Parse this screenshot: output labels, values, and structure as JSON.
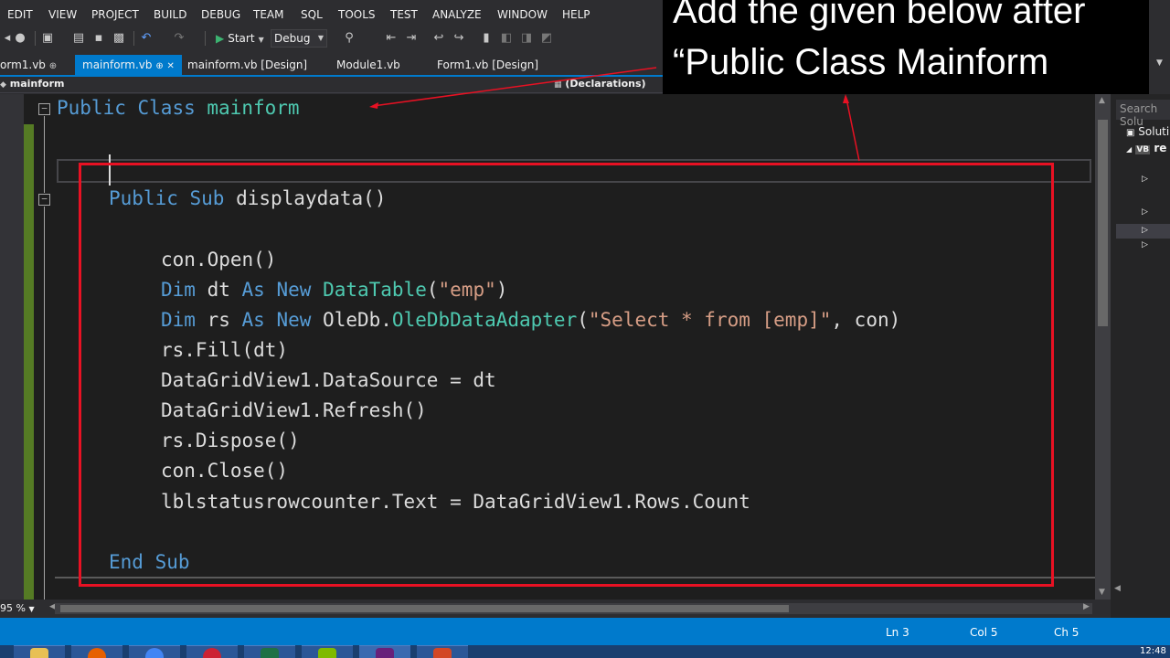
{
  "menu": [
    "EDIT",
    "VIEW",
    "PROJECT",
    "BUILD",
    "DEBUG",
    "TEAM",
    "SQL",
    "TOOLS",
    "TEST",
    "ANALYZE",
    "WINDOW",
    "HELP"
  ],
  "toolbar": {
    "start_label": "Start",
    "config_value": "Debug"
  },
  "tabs": [
    {
      "label": "orm1.vb",
      "pin": "⊕"
    },
    {
      "label": "mainform.vb",
      "pin": "⊕",
      "close": "✕"
    },
    {
      "label": "mainform.vb [Design]"
    },
    {
      "label": "Module1.vb"
    },
    {
      "label": "Form1.vb [Design]"
    }
  ],
  "navbar": {
    "scope": "mainform",
    "member": "(Declarations)"
  },
  "annotation": {
    "line1": "Add the given below after",
    "line2": "“Public Class Mainform"
  },
  "code": {
    "class_decl": {
      "kw1": "Public",
      "kw2": "Class",
      "name": "mainform"
    },
    "sub_decl": {
      "kw1": "Public",
      "kw2": "Sub",
      "rest": " displaydata()"
    },
    "l_open": "con.Open()",
    "l_dim_dt": {
      "kw1": "Dim",
      "v": " dt ",
      "kw2": "As",
      "kw3": "New",
      "type": "DataTable",
      "p1": "(",
      "str": "\"emp\"",
      "p2": ")"
    },
    "l_dim_rs": {
      "kw1": "Dim",
      "v": " rs ",
      "kw2": "As",
      "kw3": "New",
      "ns": " OleDb.",
      "type": "OleDbDataAdapter",
      "p1": "(",
      "str": "\"Select * from [emp]\"",
      "p2": ", con)"
    },
    "l_fill": "rs.Fill(dt)",
    "l_ds": "DataGridView1.DataSource = dt",
    "l_refresh": "DataGridView1.Refresh()",
    "l_dispose": "rs.Dispose()",
    "l_close": "con.Close()",
    "l_count": "lblstatusrowcounter.Text = DataGridView1.Rows.Count",
    "end_sub": {
      "kw1": "End",
      "kw2": "Sub"
    }
  },
  "zoom": "95 %",
  "solution_explorer": {
    "search_placeholder": "Search Solu",
    "items": [
      "Soluti",
      "re"
    ]
  },
  "status": {
    "line": "Ln 3",
    "col": "Col 5",
    "ch": "Ch 5"
  },
  "clock": "12:48",
  "colors": {
    "accent": "#007acc",
    "keyword": "#569cd6",
    "type": "#4ec9b0",
    "string": "#d69d85",
    "highlight_box": "#e81123"
  }
}
